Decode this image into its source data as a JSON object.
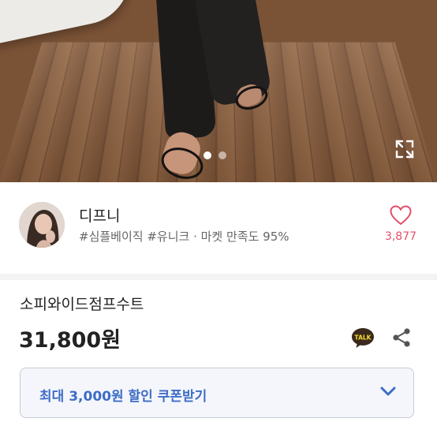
{
  "gallery": {
    "total_slides": 2,
    "active_slide": 1
  },
  "seller": {
    "name": "디프니",
    "tags": "#심플베이직 #유니크 · 마켓 만족도 95%",
    "likes": "3,877"
  },
  "product": {
    "title": "소피와이드점프수트",
    "price": "31,800원"
  },
  "actions": {
    "talk_label": "TALK"
  },
  "coupon": {
    "label": "최대 3,000원 할인 쿠폰받기"
  },
  "colors": {
    "accent_blue": "#3e6cc6",
    "heart_pink": "#e24f6a",
    "talk_yellow": "#f8dd2e"
  },
  "icons": [
    "expand-icon",
    "heart-icon",
    "talk-icon",
    "share-icon",
    "chevron-down-icon"
  ]
}
